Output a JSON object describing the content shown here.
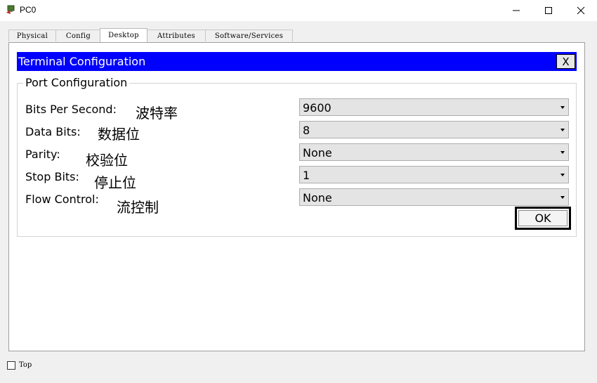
{
  "window": {
    "title": "PC0"
  },
  "tabs": [
    {
      "label": "Physical"
    },
    {
      "label": "Config"
    },
    {
      "label": "Desktop"
    },
    {
      "label": "Attributes"
    },
    {
      "label": "Software/Services"
    }
  ],
  "active_tab": "Desktop",
  "dialog": {
    "title": "Terminal Configuration",
    "close_label": "X",
    "group_title": "Port Configuration",
    "fields": [
      {
        "label": "Bits Per Second:",
        "annotation": "波特率",
        "value": "9600"
      },
      {
        "label": "Data Bits:",
        "annotation": "数据位",
        "value": "8"
      },
      {
        "label": "Parity:",
        "annotation": "校验位",
        "value": "None"
      },
      {
        "label": "Stop Bits:",
        "annotation": "停止位",
        "value": "1"
      },
      {
        "label": "Flow Control:",
        "annotation": "流控制",
        "value": "None"
      }
    ],
    "ok_label": "OK"
  },
  "footer": {
    "top_label": "Top",
    "top_checked": false
  },
  "colors": {
    "dialog_header": "#0000ff",
    "dialog_title_text": "#ffffff"
  }
}
